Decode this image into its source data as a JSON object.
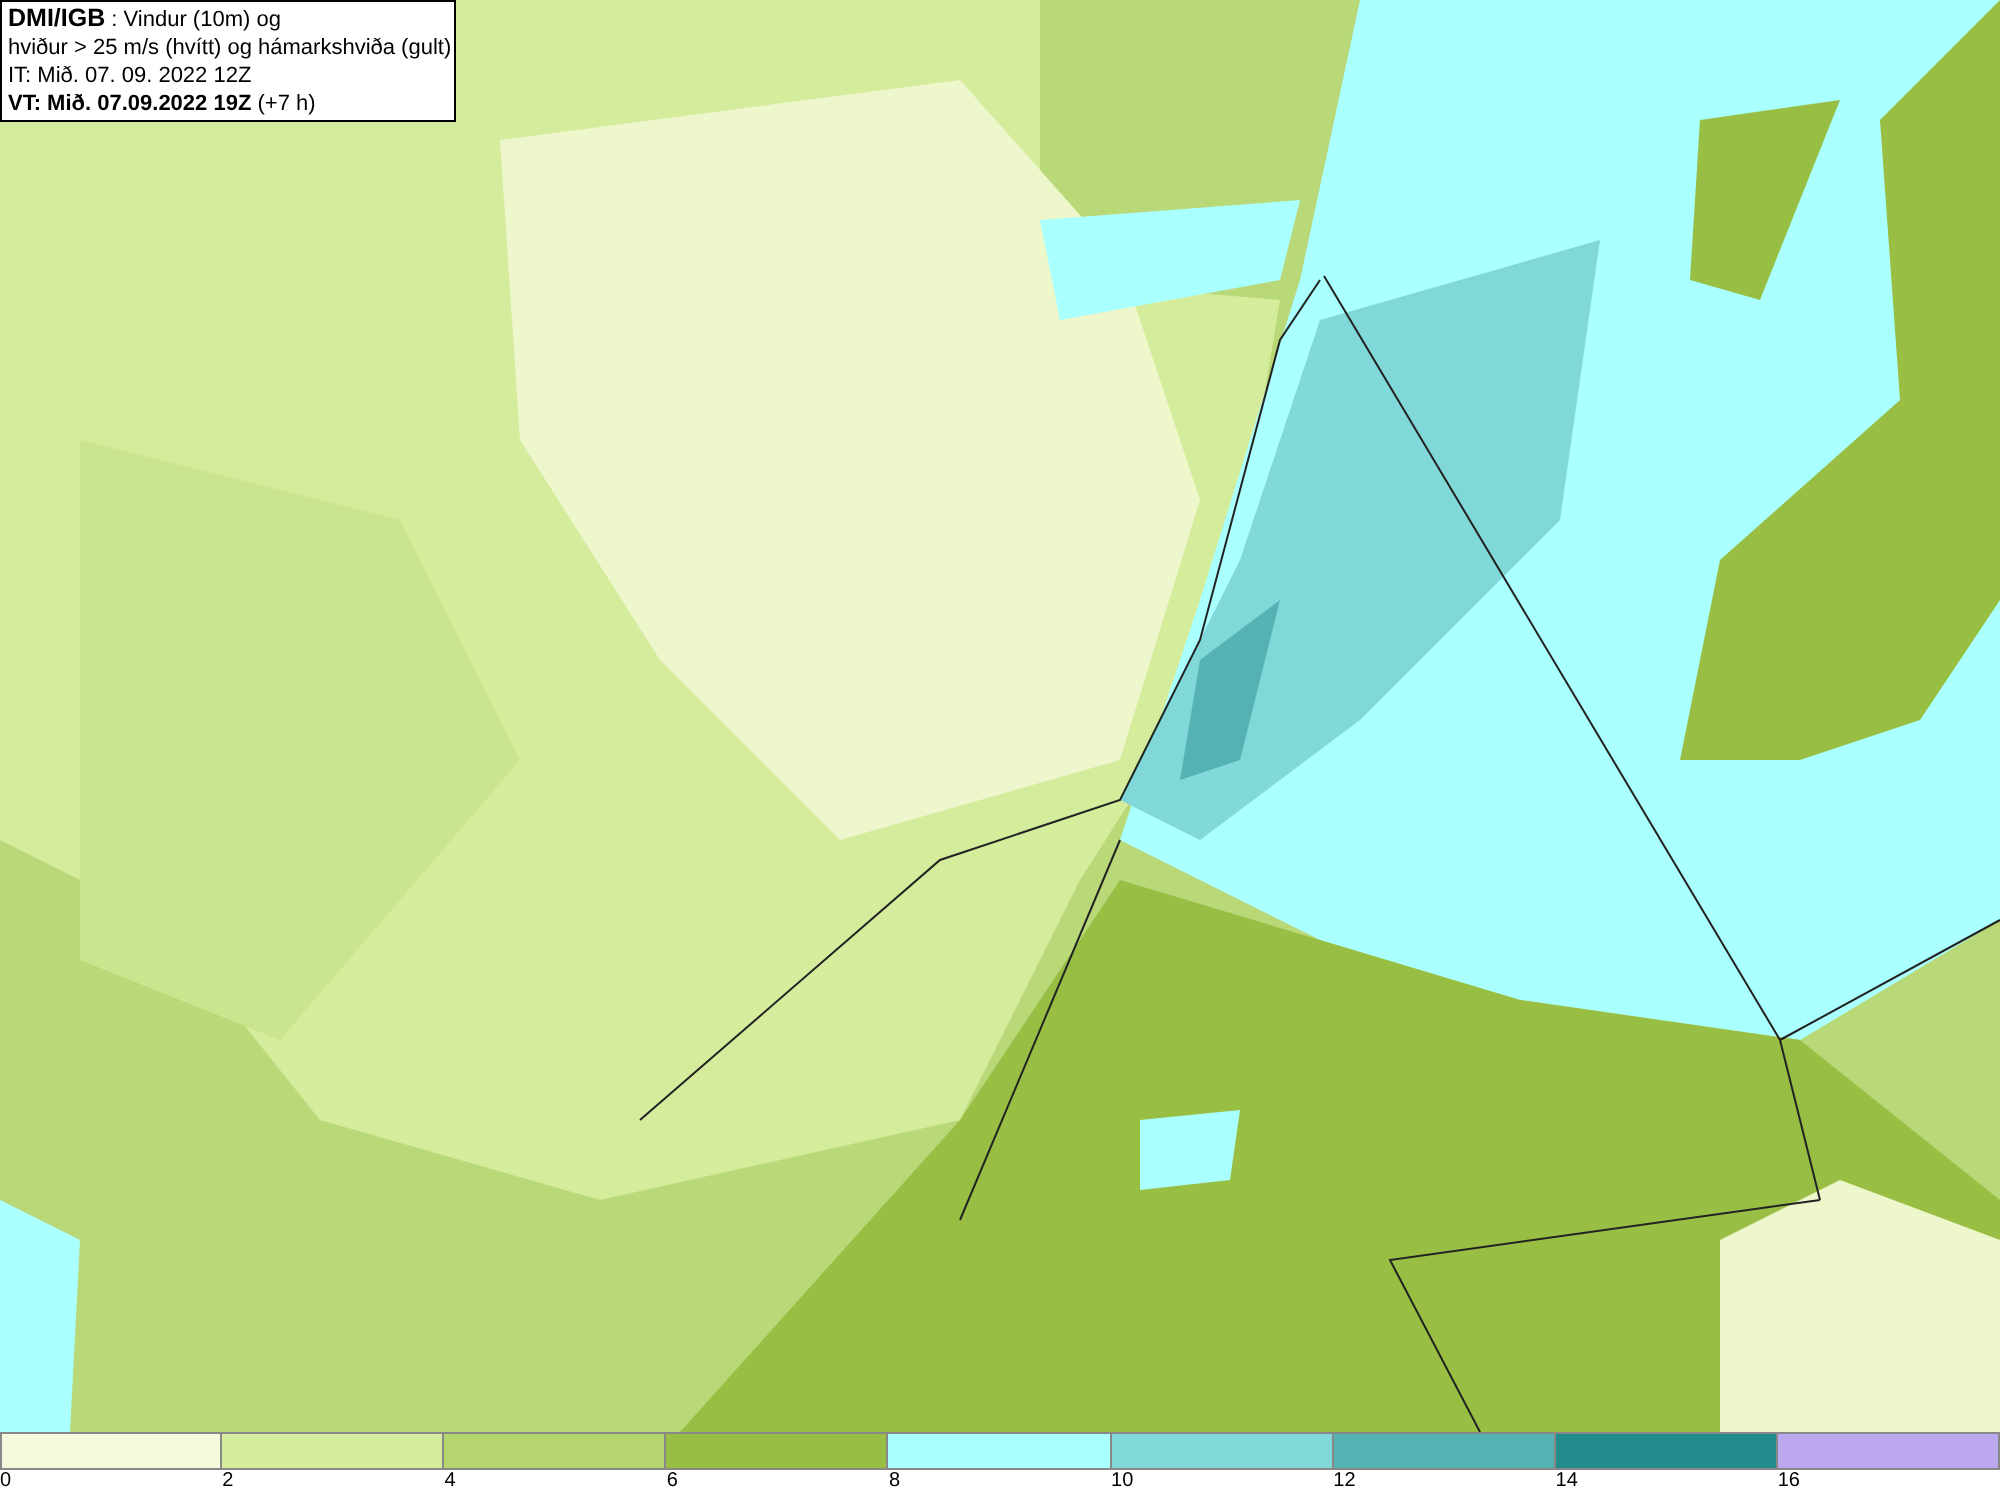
{
  "title_box": {
    "lines": [
      "**DMI/IGB** : Vindur (10m) og",
      "hviður > 25 m/s (hvítt) og hámarkshviða (gult)",
      "IT: Mið. 07. 09. 2022 12Z",
      "**VT: Mið. 07.09.2022 19Z** (+7 h)"
    ]
  },
  "legend": {
    "segments": [
      {
        "color": "#f5fadc",
        "label": "0"
      },
      {
        "color": "#d4ec9c",
        "label": "2"
      },
      {
        "color": "#b5d56e",
        "label": "4"
      },
      {
        "color": "#98bf44",
        "label": "6"
      },
      {
        "color": "#aaffff",
        "label": "8"
      },
      {
        "color": "#80d8d8",
        "label": "10"
      },
      {
        "color": "#55b2b2",
        "label": "12"
      },
      {
        "color": "#228c8c",
        "label": "14"
      },
      {
        "color": "#bba8ee",
        "label": "16"
      }
    ]
  }
}
